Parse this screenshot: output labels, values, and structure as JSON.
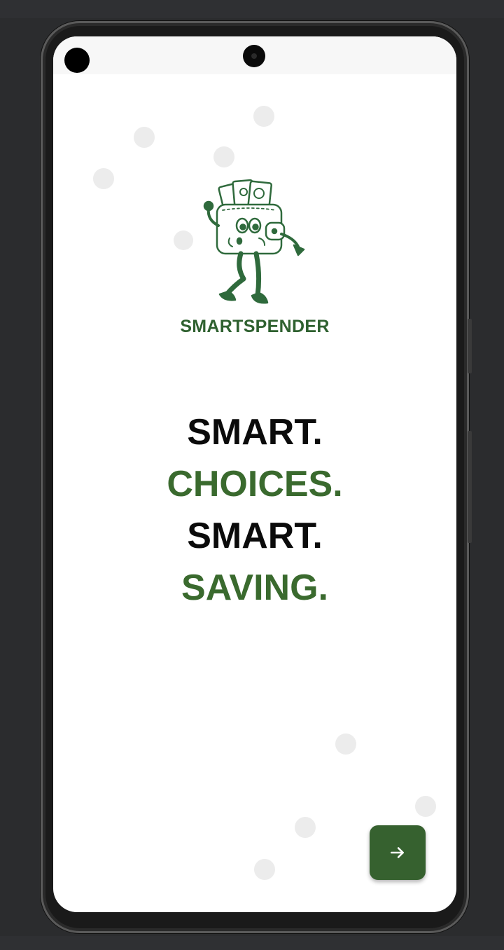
{
  "app": {
    "brand_name": "SMARTSPENDER",
    "logo_icon": "wallet-mascot-icon"
  },
  "tagline": {
    "line1": "SMART.",
    "line2": "CHOICES.",
    "line3": "SMART.",
    "line4": "SAVING."
  },
  "actions": {
    "next_icon": "arrow-right-icon"
  },
  "colors": {
    "accent_green": "#36612f",
    "text_dark": "#0b0b0b",
    "background": "#ffffff"
  }
}
